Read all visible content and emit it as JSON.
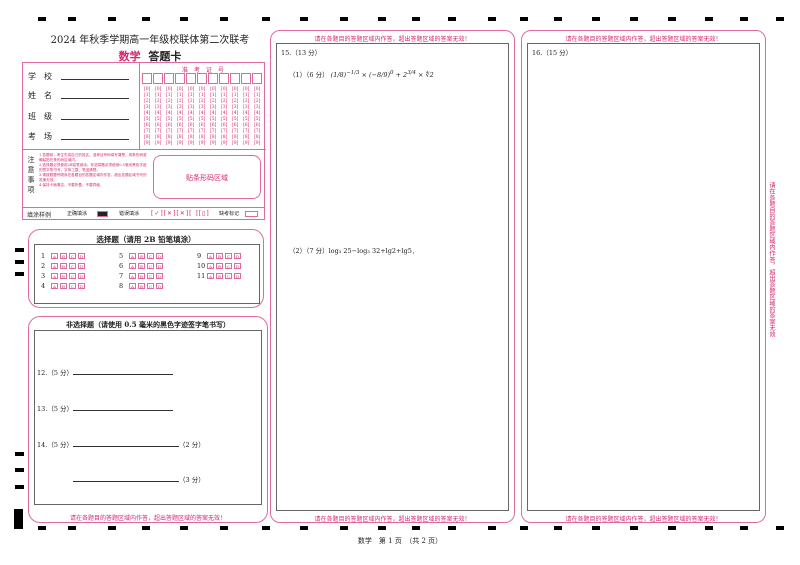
{
  "header": {
    "title": "2024 年秋季学期高一年级校联体第二次联考",
    "subject": "数学",
    "card_label": "答题卡"
  },
  "info": {
    "school": "学　校",
    "name": "姓　名",
    "class": "班　级",
    "room": "考　场",
    "exam_no_label": "准　考　证　号",
    "barcode": "贴条形码区域"
  },
  "notes": {
    "label": "注意事项",
    "items": [
      "1.答题前，考生先将自己的姓名、准考证号码填写清楚，将条形码准确粘贴在条形码区域内。",
      "2.选择题必须使用2B铅笔填涂；非选择题必须使用0.5毫米黑色字迹的签字笔书写，字体工整、笔迹清楚。",
      "3.请按照题号顺序在各题目的答题区域内作答，超出答题区域书写的答案无效。",
      "4.保持卡面清洁，不要折叠、不要弄破。"
    ]
  },
  "fill": {
    "label": "填涂样例",
    "correct": "正确填涂",
    "wrong": "错误填涂",
    "absent": "缺考标记"
  },
  "choice": {
    "title": "选择题（请用 2B 铅笔填涂）",
    "numbers_col1": [
      "1",
      "2",
      "3",
      "4"
    ],
    "numbers_col2": [
      "5",
      "6",
      "7",
      "8"
    ],
    "numbers_col3": [
      "9",
      "10",
      "11"
    ],
    "options": [
      "A",
      "B",
      "C",
      "D"
    ]
  },
  "nonchoice": {
    "title": "非选择题（请使用 0.5 毫米的黑色字迹签字笔书写）",
    "q12": "12.（5 分）",
    "q13": "13.（5 分）",
    "q14": "14.（5 分）",
    "q14_p1": "（2 分）",
    "q14_p2": "（3 分）"
  },
  "warning": "请在各题目的答题区域内作答，超出答题区域的答案无效！",
  "q15": {
    "label": "15.（13 分）",
    "part1": "（1）（6 分）",
    "part2": "（2）（7 分）log₃ 25−log₃ 32+lg2+lg5．"
  },
  "q16": {
    "label": "16.（15 分）"
  },
  "side_warning": "请在各题目的答题区域内作答，超出答题区域的答案无效",
  "footer": "数学　第 1 页　（共 2 页）"
}
